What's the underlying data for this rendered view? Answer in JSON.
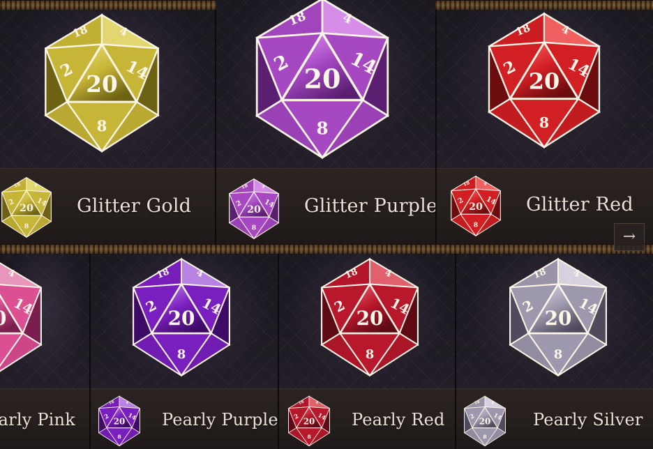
{
  "dice_top": [
    {
      "name": "Glitter Gold",
      "base": "#c7b537",
      "light": "#efe37a",
      "dark": "#6d6114"
    },
    {
      "name": "Glitter Purple",
      "base": "#a548c2",
      "light": "#e39af5",
      "dark": "#5b1f72"
    },
    {
      "name": "Glitter Red",
      "base": "#d21f24",
      "light": "#ff6a6a",
      "dark": "#6c0c0e"
    }
  ],
  "dice_bottom": [
    {
      "name": "Pearly Pink",
      "base": "#dc4f93",
      "light": "#f5a2c8",
      "dark": "#7a1e4d"
    },
    {
      "name": "Pearly Purple",
      "base": "#7a1fbf",
      "light": "#c58ff0",
      "dark": "#3d0b66"
    },
    {
      "name": "Pearly Red",
      "base": "#b8172c",
      "light": "#ef6a78",
      "dark": "#5e0a15"
    },
    {
      "name": "Pearly Silver",
      "base": "#9d98ad",
      "light": "#e4e1ec",
      "dark": "#4f4b5c"
    }
  ],
  "face_numbers": {
    "center": "20",
    "left": "2",
    "right": "14",
    "top_left": "18",
    "top_right": "4",
    "bottom": "8"
  },
  "next_icon": "→"
}
